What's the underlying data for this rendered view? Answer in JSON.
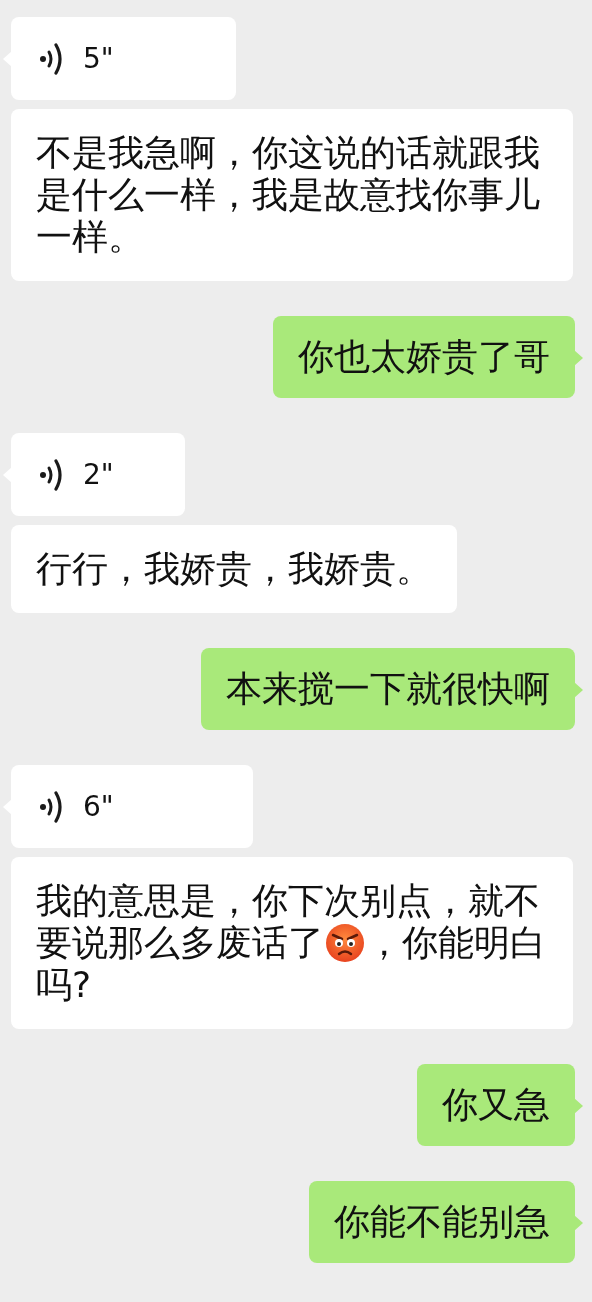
{
  "messages": [
    {
      "kind": "voice",
      "duration": "5\""
    },
    {
      "kind": "transcript",
      "parts": [
        {
          "kind": "text",
          "text": "不是我急啊，你这说的话就跟我是什么一样，我是故意找你事儿一样。"
        }
      ]
    },
    {
      "kind": "sent",
      "parts": [
        {
          "kind": "text",
          "text": "你也太娇贵了哥"
        }
      ]
    },
    {
      "kind": "voice",
      "duration": "2\""
    },
    {
      "kind": "transcript",
      "parts": [
        {
          "kind": "text",
          "text": "行行，我娇贵，我娇贵。"
        }
      ]
    },
    {
      "kind": "sent",
      "parts": [
        {
          "kind": "text",
          "text": "本来搅一下就很快啊"
        }
      ]
    },
    {
      "kind": "voice",
      "duration": "6\""
    },
    {
      "kind": "transcript",
      "parts": [
        {
          "kind": "text",
          "text": "我的意思是，你下次别点，就不要说那么多废话了"
        },
        {
          "kind": "emoji"
        },
        {
          "kind": "text",
          "text": "，你能明白吗?"
        }
      ]
    },
    {
      "kind": "sent",
      "parts": [
        {
          "kind": "text",
          "text": "你又急"
        }
      ]
    },
    {
      "kind": "sent",
      "parts": [
        {
          "kind": "text",
          "text": "你能不能别急"
        }
      ]
    }
  ]
}
